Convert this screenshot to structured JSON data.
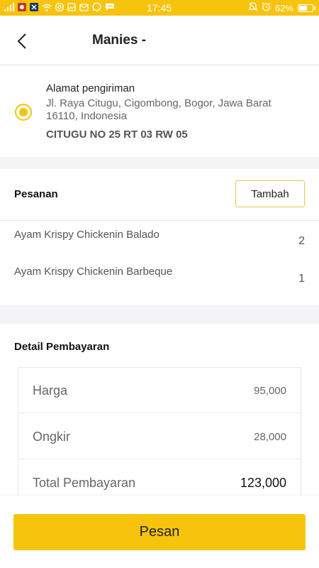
{
  "colors": {
    "accent": "#f6c40c",
    "background": "#f4f4f6"
  },
  "status_bar": {
    "time": "17:45",
    "battery": "62%",
    "battery_level": 0.62,
    "left_icons": [
      "signal-icon",
      "app-icon",
      "app-icon",
      "wifi-icon",
      "instagram-icon",
      "gallery-icon",
      "mail-icon",
      "whatsapp-icon",
      "chat-icon"
    ],
    "right_icons": [
      "mute-icon",
      "alarm-icon",
      "battery-icon"
    ]
  },
  "header": {
    "title": "Manies -",
    "back_icon": "chevron-left-icon"
  },
  "address": {
    "label": "Alamat pengiriman",
    "text": "Jl. Raya Citugu, Cigombong, Bogor, Jawa Barat 16110, Indonesia",
    "detail": "CITUGU NO 25 RT 03 RW 05",
    "selected": true
  },
  "orders": {
    "title": "Pesanan",
    "add_label": "Tambah",
    "items": [
      {
        "name": "Ayam Krispy Chickenin Balado",
        "qty": "2"
      },
      {
        "name": "Ayam Krispy Chickenin Barbeque",
        "qty": "1"
      }
    ]
  },
  "payment": {
    "title": "Detail Pembayaran",
    "rows": [
      {
        "label": "Harga",
        "value": "95,000"
      },
      {
        "label": "Ongkir",
        "value": "28,000"
      },
      {
        "label": "Total Pembayaran",
        "value": "123,000"
      }
    ]
  },
  "checkout": {
    "label": "Pesan"
  }
}
